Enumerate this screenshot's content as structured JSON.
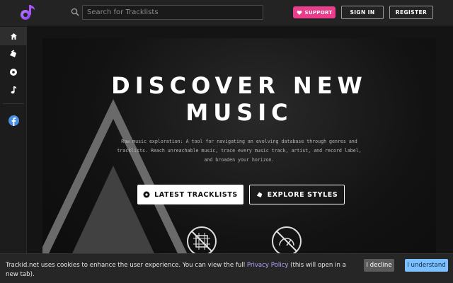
{
  "header": {
    "search_placeholder": "Search for Tracklists",
    "support_label": "SUPPORT",
    "signin_label": "SIGN IN",
    "register_label": "REGISTER"
  },
  "sidebar": {
    "items": [
      {
        "icon": "home-icon"
      },
      {
        "icon": "tag-icon"
      },
      {
        "icon": "record-icon"
      },
      {
        "icon": "music-note-icon"
      },
      {
        "icon": "facebook-icon"
      }
    ]
  },
  "hero": {
    "title_line1": "DISCOVER NEW",
    "title_line2": "MUSIC",
    "desc_line1": "Raw music exploration: A tool for navigating an evolving database through genres and",
    "desc_line2": "tracklists. Reach unreachable music, trace every music track, artist, and record label,",
    "desc_line3": "and broaden your horizon.",
    "latest_label": "LATEST TRACKLISTS",
    "explore_label": "EXPLORE STYLES"
  },
  "cookie": {
    "text_before": "Trackid.net uses cookies to enhance the user experience. You can view the full ",
    "link_label": "Privacy Policy",
    "text_after": " (this will open in a new tab).",
    "decline_label": "I decline",
    "accept_label": "I understand"
  },
  "colors": {
    "accent": "#e83e8c",
    "logo": "#8b5cf6",
    "accept": "#7cc0ff",
    "link": "#b9a2ff"
  }
}
